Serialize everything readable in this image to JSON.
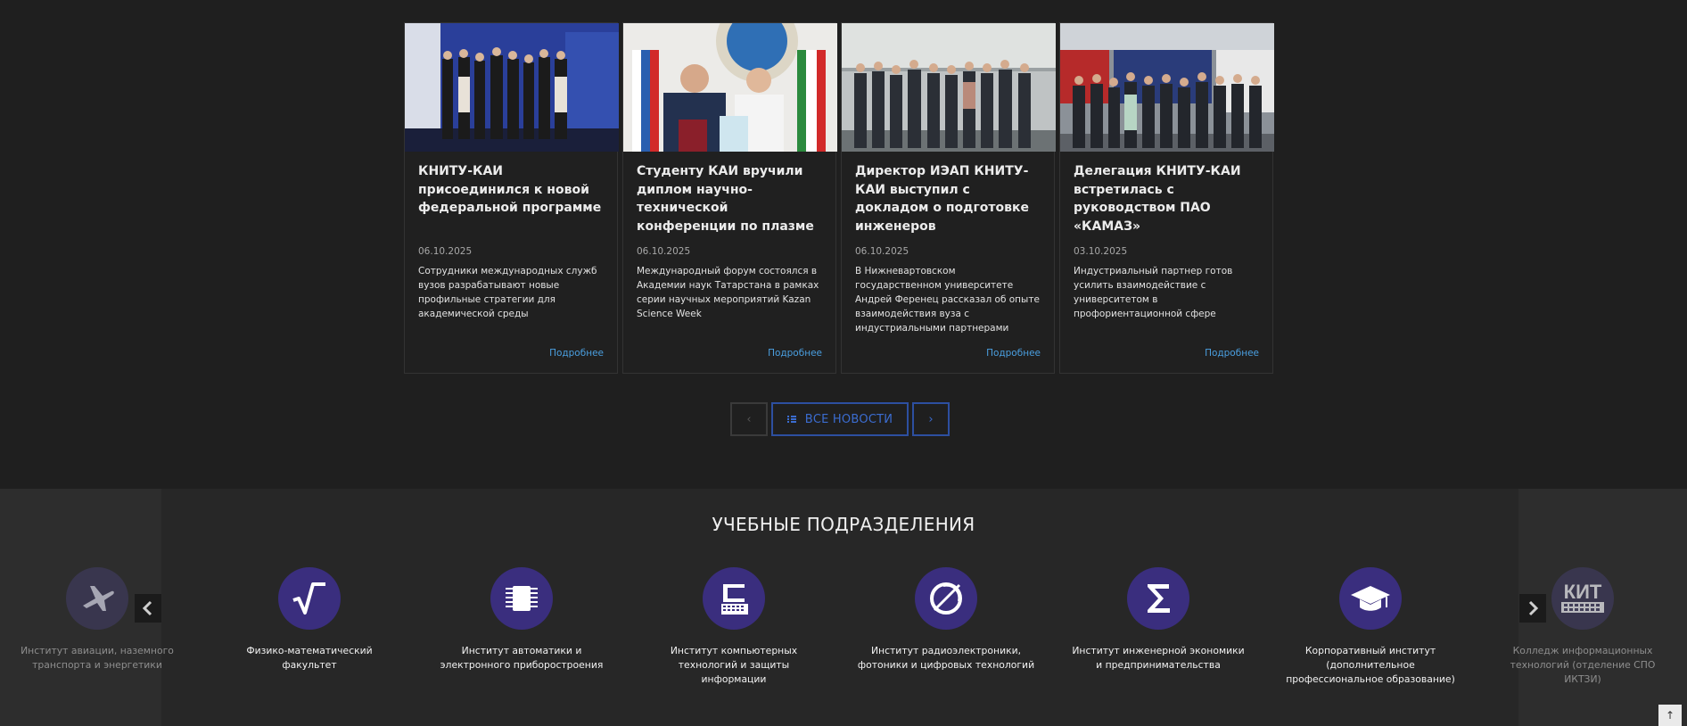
{
  "news": {
    "cards": [
      {
        "title": "КНИТУ-КАИ присоединился к новой федеральной программе",
        "date": "06.10.2025",
        "text": "Сотрудники международных служб вузов разрабатывают новые профильные стратегии для академической среды",
        "more": "Подробнее"
      },
      {
        "title": "Студенту КАИ вручили диплом научно-технической конференции по плазме",
        "date": "06.10.2025",
        "text": "Международный форум состоялся в Академии наук Татарстана в рамках серии научных мероприятий Kazan Science Week",
        "more": "Подробнее"
      },
      {
        "title": "Директор ИЭАП КНИТУ-КАИ выступил с докладом о подготовке инженеров",
        "date": "06.10.2025",
        "text": "В Нижневартовском государственном университете Андрей Ференец рассказал об опыте взаимодействия вуза с индустриальными партнерами",
        "more": "Подробнее"
      },
      {
        "title": "Делегация КНИТУ-КАИ встретилась с руководством ПАО «КАМАЗ»",
        "date": "03.10.2025",
        "text": "Индустриальный партнер готов усилить взаимодействие с университетом в профориентационной сфере",
        "more": "Подробнее"
      }
    ],
    "pager": {
      "prev": "‹",
      "all": "ВСЕ НОВОСТИ",
      "next": "›"
    }
  },
  "divisions": {
    "title": "УЧЕБНЫЕ ПОДРАЗДЕЛЕНИЯ",
    "units": [
      {
        "name": "Институт авиации, наземного транспорта и энергетики",
        "icon": "airplane-icon"
      },
      {
        "name": "Физико-математический факультет",
        "icon": "square-root-icon"
      },
      {
        "name": "Институт автоматики и электронного приборостроения",
        "icon": "chip-icon"
      },
      {
        "name": "Институт компьютерных технологий и защиты информации",
        "icon": "computer-icon"
      },
      {
        "name": "Институт радиоэлектроники, фотоники и цифровых технологий",
        "icon": "radar-icon"
      },
      {
        "name": "Институт инженерной экономики и предпринимательства",
        "icon": "sigma-icon"
      },
      {
        "name": "Корпоративный институт (дополнительное профессиональное образование)",
        "icon": "graduation-cap-icon"
      },
      {
        "name": "Колледж информационных технологий (отделение СПО ИКТЗИ)",
        "icon": "kit-logo-icon",
        "logo_text": "КИТ"
      }
    ]
  },
  "scroll_top": "↑"
}
